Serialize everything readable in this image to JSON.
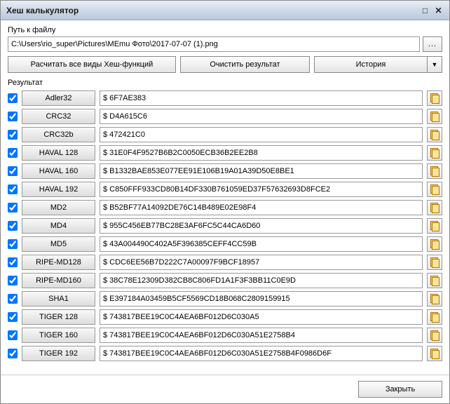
{
  "window": {
    "title": "Хеш калькулятор"
  },
  "labels": {
    "path": "Путь к файлу",
    "result": "Результат"
  },
  "path": {
    "value": "C:\\Users\\rio_super\\Pictures\\MEmu Фото\\2017-07-07 (1).png",
    "browse": "..."
  },
  "buttons": {
    "calc": "Расчитать все виды Хеш-функций",
    "clear": "Очистить результат",
    "history": "История",
    "history_arrow": "▼",
    "close": "Закрыть"
  },
  "results": [
    {
      "algo": "Adler32",
      "hash": "$ 6F7AE383"
    },
    {
      "algo": "CRC32",
      "hash": "$ D4A615C6"
    },
    {
      "algo": "CRC32b",
      "hash": "$ 472421C0"
    },
    {
      "algo": "HAVAL 128",
      "hash": "$ 31E0F4F9527B6B2C0050ECB36B2EE2B8"
    },
    {
      "algo": "HAVAL 160",
      "hash": "$ B1332BAE853E077EE91E106B19A01A39D50E8BE1"
    },
    {
      "algo": "HAVAL 192",
      "hash": "$ C850FFF933CD80B14DF330B761059ED37F57632693D8FCE2"
    },
    {
      "algo": "MD2",
      "hash": "$ B52BF77A14092DE76C14B489E02E98F4"
    },
    {
      "algo": "MD4",
      "hash": "$ 955C456EB77BC28E3AF6FC5C44CA6D60"
    },
    {
      "algo": "MD5",
      "hash": "$ 43A004490C402A5F396385CEFF4CC59B"
    },
    {
      "algo": "RIPE-MD128",
      "hash": "$ CDC6EE56B7D222C7A00097F9BCF18957"
    },
    {
      "algo": "RIPE-MD160",
      "hash": "$ 38C78E12309D382CB8C806FD1A1F3F3BB11C0E9D"
    },
    {
      "algo": "SHA1",
      "hash": "$ E397184A03459B5CF5569CD18B068C2809159915"
    },
    {
      "algo": "TIGER 128",
      "hash": "$ 743817BEE19C0C4AEA6BF012D6C030A5"
    },
    {
      "algo": "TIGER 160",
      "hash": "$ 743817BEE19C0C4AEA6BF012D6C030A51E2758B4"
    },
    {
      "algo": "TIGER 192",
      "hash": "$ 743817BEE19C0C4AEA6BF012D6C030A51E2758B4F0986D6F"
    }
  ]
}
